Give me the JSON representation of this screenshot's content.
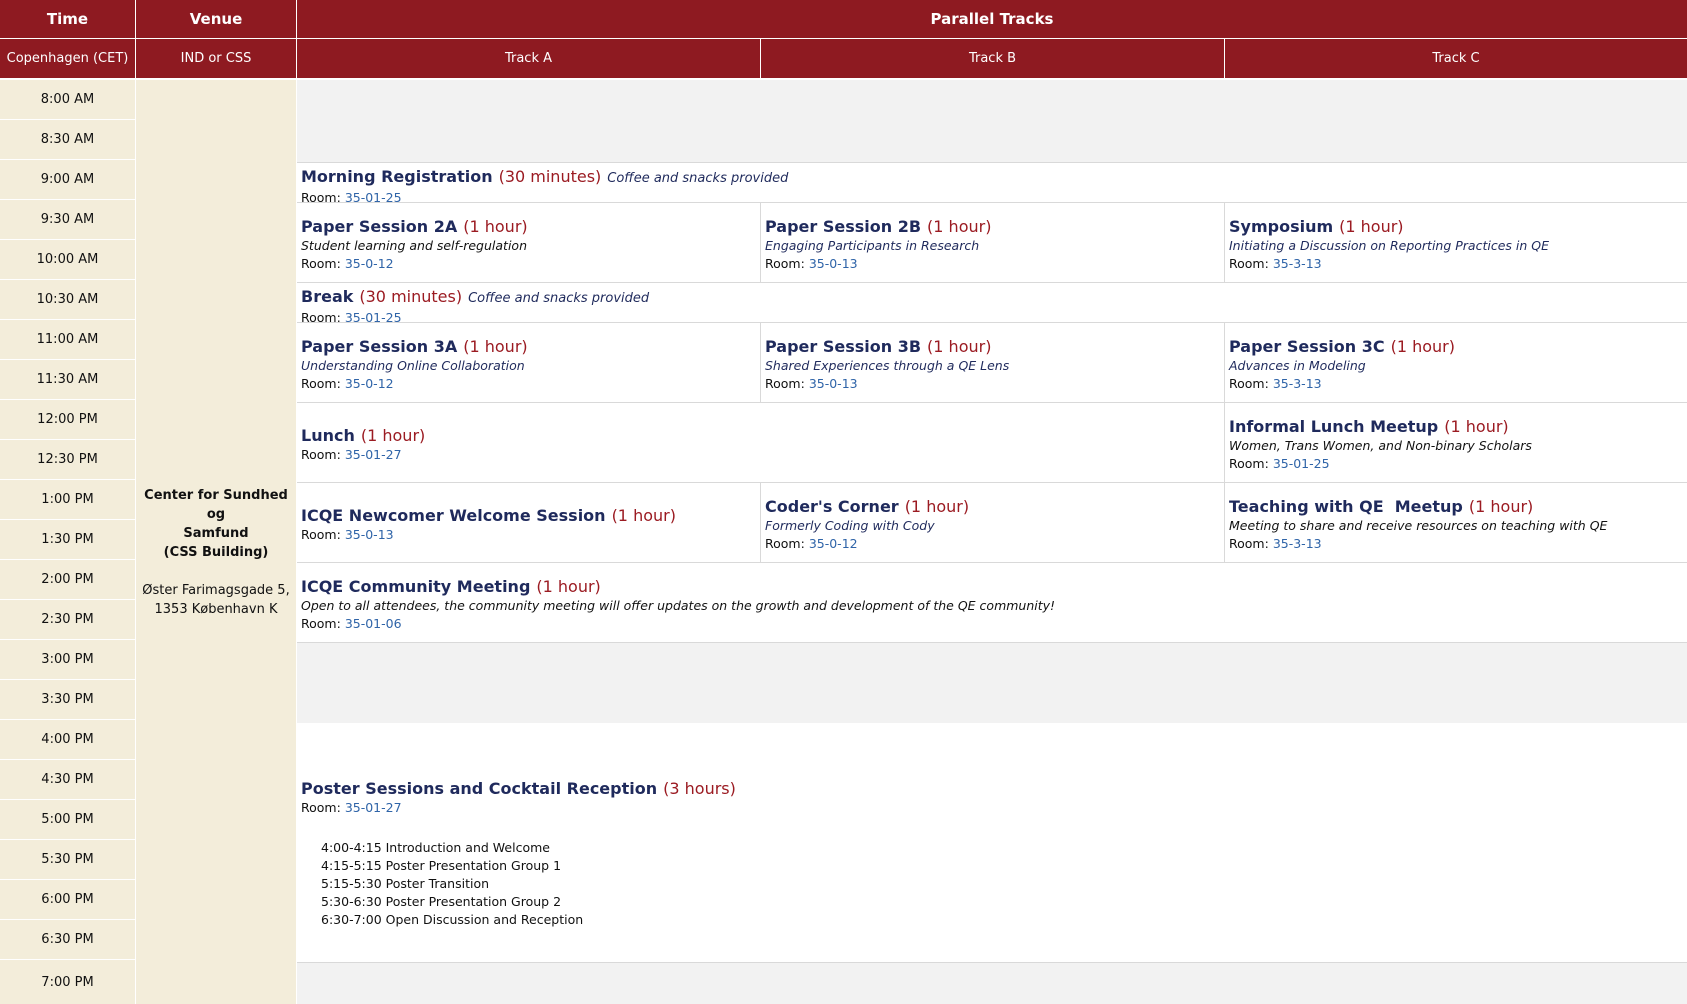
{
  "header": {
    "time": "Time",
    "venue": "Venue",
    "parallel": "Parallel Tracks",
    "timezone": "Copenhagen (CET)",
    "venue_sub": "IND or CSS",
    "track_a": "Track A",
    "track_b": "Track B",
    "track_c": "Track C"
  },
  "times": [
    "8:00 AM",
    "8:30 AM",
    "9:00 AM",
    "9:30 AM",
    "10:00 AM",
    "10:30 AM",
    "11:00 AM",
    "11:30 AM",
    "12:00 PM",
    "12:30 PM",
    "1:00 PM",
    "1:30 PM",
    "2:00 PM",
    "2:30 PM",
    "3:00 PM",
    "3:30 PM",
    "4:00 PM",
    "4:30 PM",
    "5:00 PM",
    "5:30 PM",
    "6:00 PM",
    "6:30 PM",
    "7:00 PM"
  ],
  "venue": {
    "name": "Center for Sundhed og\nSamfund\n(CSS Building)",
    "address": "Øster Farimagsgade 5,\n1353 København K"
  },
  "room_label": "Room:",
  "events": {
    "registration": {
      "title": "Morning Registration",
      "duration": "(30 minutes)",
      "note": "Coffee and snacks provided",
      "room": "35-01-25"
    },
    "ps2a": {
      "title": "Paper Session 2A",
      "duration": "(1 hour)",
      "subtitle": "Student learning and self-regulation",
      "room": "35-0-12"
    },
    "ps2b": {
      "title": "Paper Session 2B",
      "duration": "(1 hour)",
      "subtitle": "Engaging Participants in Research",
      "room": "35-0-13"
    },
    "symposium": {
      "title": "Symposium",
      "duration": "(1 hour)",
      "subtitle": "Initiating a Discussion on Reporting Practices in QE",
      "room": "35-3-13"
    },
    "break": {
      "title": "Break",
      "duration": "(30 minutes)",
      "note": "Coffee and snacks provided",
      "room": "35-01-25"
    },
    "ps3a": {
      "title": "Paper Session 3A",
      "duration": "(1 hour)",
      "subtitle": "Understanding Online Collaboration",
      "room": "35-0-12"
    },
    "ps3b": {
      "title": "Paper Session 3B",
      "duration": "(1 hour)",
      "subtitle": "Shared Experiences through a QE Lens",
      "room": "35-0-13"
    },
    "ps3c": {
      "title": "Paper Session 3C",
      "duration": "(1 hour)",
      "subtitle": "Advances in Modeling",
      "room": "35-3-13"
    },
    "lunch": {
      "title": "Lunch",
      "duration": "(1 hour)",
      "room": "35-01-27"
    },
    "lunch_meetup": {
      "title": "Informal Lunch Meetup",
      "duration": "(1 hour)",
      "subtitle": "Women, Trans Women, and Non-binary Scholars",
      "room": "35-01-25"
    },
    "newcomer": {
      "title": "ICQE Newcomer Welcome Session",
      "duration": "(1 hour)",
      "room": "35-0-13"
    },
    "coders": {
      "title": "Coder's Corner",
      "duration": "(1 hour)",
      "subtitle": "Formerly Coding with Cody",
      "room": "35-0-12"
    },
    "teaching": {
      "title": "Teaching with QE  Meetup",
      "duration": "(1 hour)",
      "subtitle": "Meeting to share and receive resources on teaching with QE",
      "room": "35-3-13"
    },
    "community": {
      "title": "ICQE Community Meeting",
      "duration": "(1 hour)",
      "subtitle": "Open to all attendees, the community meeting will offer updates on the growth and development of the QE community!",
      "room": "35-01-06"
    },
    "poster": {
      "title": "Poster Sessions and Cocktail Reception",
      "duration": "(3 hours)",
      "room": "35-01-27",
      "schedule": [
        "4:00-4:15 Introduction and Welcome",
        "4:15-5:15 Poster Presentation Group 1",
        "5:15-5:30 Poster Transition",
        "5:30-6:30 Poster Presentation Group 2",
        "6:30-7:00 Open Discussion and Reception"
      ]
    }
  }
}
